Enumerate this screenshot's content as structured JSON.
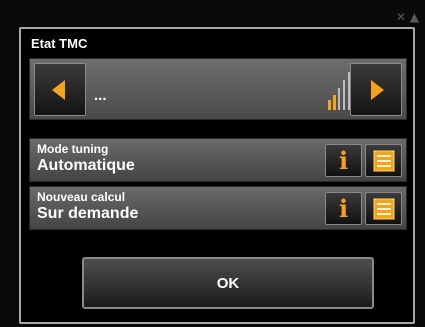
{
  "dialog": {
    "title": "Etat TMC"
  },
  "station_selector": {
    "value": "...",
    "prev_icon": "arrow-left-icon",
    "next_icon": "arrow-right-icon",
    "signal_icon": "signal-strength-icon"
  },
  "options": [
    {
      "label": "Mode tuning",
      "value": "Automatique"
    },
    {
      "label": "Nouveau calcul",
      "value": "Sur demande"
    }
  ],
  "buttons": {
    "ok_label": "OK",
    "info_glyph": "i"
  },
  "colors": {
    "accent": "#f7a21b",
    "panel": "#5a5a5a",
    "background": "#000000"
  }
}
